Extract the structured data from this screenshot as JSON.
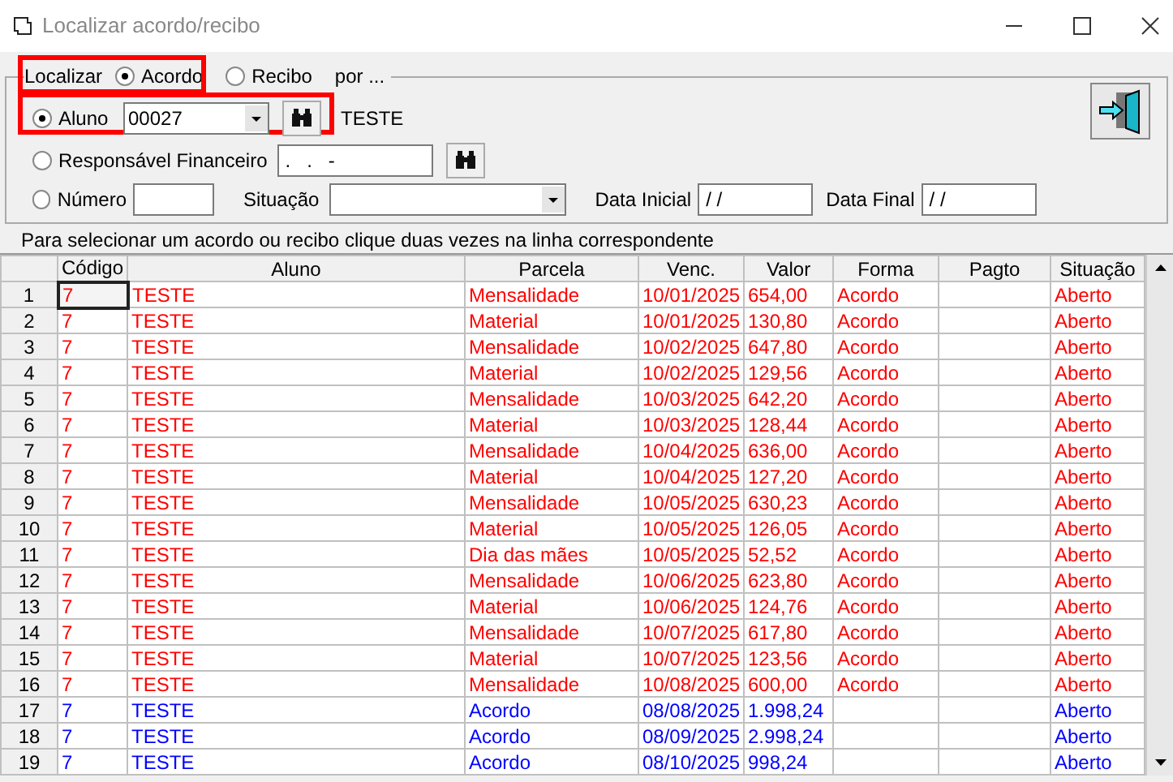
{
  "window": {
    "title": "Localizar acordo/recibo"
  },
  "search": {
    "localizar_label": "Localizar",
    "type_options": [
      {
        "label": "Acordo",
        "selected": true
      },
      {
        "label": "Recibo",
        "selected": false
      }
    ],
    "por_label": "por ...",
    "aluno": {
      "label": "Aluno",
      "selected": true,
      "value": "00027",
      "result": "TESTE"
    },
    "responsavel": {
      "label": "Responsável Financeiro",
      "selected": false,
      "value": ".   .   -"
    },
    "numero": {
      "label": "Número",
      "selected": false
    },
    "situacao_label": "Situação",
    "data_inicial": {
      "label": "Data Inicial",
      "value": "/ /"
    },
    "data_final": {
      "label": "Data Final",
      "value": "/ /"
    }
  },
  "hint": "Para selecionar um acordo ou recibo clique duas vezes na linha correspondente",
  "table": {
    "columns": [
      "Código",
      "Aluno",
      "Parcela",
      "Venc.",
      "Valor",
      "Forma",
      "Pagto",
      "Situação"
    ],
    "rows": [
      {
        "n": "1",
        "cells": [
          "7",
          "TESTE",
          "Mensalidade",
          "10/01/2025",
          "654,00",
          "Acordo",
          "",
          "Aberto"
        ],
        "color": "#ff0000",
        "selected": true
      },
      {
        "n": "2",
        "cells": [
          "7",
          "TESTE",
          "Material",
          "10/01/2025",
          "130,80",
          "Acordo",
          "",
          "Aberto"
        ],
        "color": "#ff0000",
        "selected": false
      },
      {
        "n": "3",
        "cells": [
          "7",
          "TESTE",
          "Mensalidade",
          "10/02/2025",
          "647,80",
          "Acordo",
          "",
          "Aberto"
        ],
        "color": "#ff0000",
        "selected": false
      },
      {
        "n": "4",
        "cells": [
          "7",
          "TESTE",
          "Material",
          "10/02/2025",
          "129,56",
          "Acordo",
          "",
          "Aberto"
        ],
        "color": "#ff0000",
        "selected": false
      },
      {
        "n": "5",
        "cells": [
          "7",
          "TESTE",
          "Mensalidade",
          "10/03/2025",
          "642,20",
          "Acordo",
          "",
          "Aberto"
        ],
        "color": "#ff0000",
        "selected": false
      },
      {
        "n": "6",
        "cells": [
          "7",
          "TESTE",
          "Material",
          "10/03/2025",
          "128,44",
          "Acordo",
          "",
          "Aberto"
        ],
        "color": "#ff0000",
        "selected": false
      },
      {
        "n": "7",
        "cells": [
          "7",
          "TESTE",
          "Mensalidade",
          "10/04/2025",
          "636,00",
          "Acordo",
          "",
          "Aberto"
        ],
        "color": "#ff0000",
        "selected": false
      },
      {
        "n": "8",
        "cells": [
          "7",
          "TESTE",
          "Material",
          "10/04/2025",
          "127,20",
          "Acordo",
          "",
          "Aberto"
        ],
        "color": "#ff0000",
        "selected": false
      },
      {
        "n": "9",
        "cells": [
          "7",
          "TESTE",
          "Mensalidade",
          "10/05/2025",
          "630,23",
          "Acordo",
          "",
          "Aberto"
        ],
        "color": "#ff0000",
        "selected": false
      },
      {
        "n": "10",
        "cells": [
          "7",
          "TESTE",
          "Material",
          "10/05/2025",
          "126,05",
          "Acordo",
          "",
          "Aberto"
        ],
        "color": "#ff0000",
        "selected": false
      },
      {
        "n": "11",
        "cells": [
          "7",
          "TESTE",
          "Dia das mães",
          "10/05/2025",
          "52,52",
          "Acordo",
          "",
          "Aberto"
        ],
        "color": "#ff0000",
        "selected": false
      },
      {
        "n": "12",
        "cells": [
          "7",
          "TESTE",
          "Mensalidade",
          "10/06/2025",
          "623,80",
          "Acordo",
          "",
          "Aberto"
        ],
        "color": "#ff0000",
        "selected": false
      },
      {
        "n": "13",
        "cells": [
          "7",
          "TESTE",
          "Material",
          "10/06/2025",
          "124,76",
          "Acordo",
          "",
          "Aberto"
        ],
        "color": "#ff0000",
        "selected": false
      },
      {
        "n": "14",
        "cells": [
          "7",
          "TESTE",
          "Mensalidade",
          "10/07/2025",
          "617,80",
          "Acordo",
          "",
          "Aberto"
        ],
        "color": "#ff0000",
        "selected": false
      },
      {
        "n": "15",
        "cells": [
          "7",
          "TESTE",
          "Material",
          "10/07/2025",
          "123,56",
          "Acordo",
          "",
          "Aberto"
        ],
        "color": "#ff0000",
        "selected": false
      },
      {
        "n": "16",
        "cells": [
          "7",
          "TESTE",
          "Mensalidade",
          "10/08/2025",
          "600,00",
          "Acordo",
          "",
          "Aberto"
        ],
        "color": "#ff0000",
        "selected": false
      },
      {
        "n": "17",
        "cells": [
          "7",
          "TESTE",
          "Acordo",
          "08/08/2025",
          "1.998,24",
          "",
          "",
          "Aberto"
        ],
        "color": "#0000ff",
        "selected": false
      },
      {
        "n": "18",
        "cells": [
          "7",
          "TESTE",
          "Acordo",
          "08/09/2025",
          "2.998,24",
          "",
          "",
          "Aberto"
        ],
        "color": "#0000ff",
        "selected": false
      },
      {
        "n": "19",
        "cells": [
          "7",
          "TESTE",
          "Acordo",
          "08/10/2025",
          "998,24",
          "",
          "",
          "Aberto"
        ],
        "color": "#0000ff",
        "selected": false
      }
    ]
  }
}
